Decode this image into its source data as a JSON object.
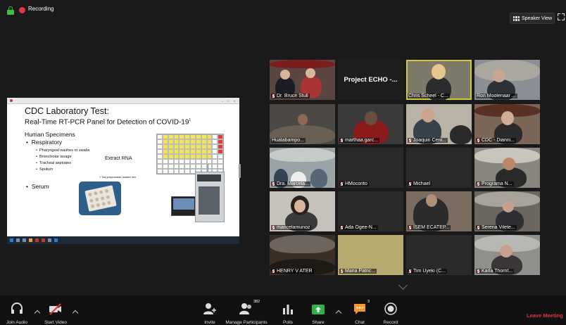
{
  "topbar": {
    "recording_label": "Recording",
    "speaker_view_label": "Speaker View"
  },
  "share": {
    "slide": {
      "title": "CDC Laboratory Test:",
      "subtitle_prefix": "Real-Time RT-PCR Panel for Detection of COVID-19",
      "subtitle_sup": "1",
      "specimens_heading": "Human Specimens",
      "bullet_respiratory": "Respiratory",
      "sub_bullets": [
        "Pharyngeal washes or swabs",
        "Bronchiolar lavage",
        "Tracheal aspirates",
        "Sputum"
      ],
      "bullet_serum": "Serum",
      "extract_label": "Extract RNA",
      "taq_label": "+ Taq polymerase master mix"
    }
  },
  "gallery": {
    "tiles": [
      {
        "name": "Dr. Bruce Stull",
        "muted": true
      },
      {
        "name": "Project ECHO -...",
        "muted": false,
        "name_only": true
      },
      {
        "name": "Chris Scheel - C...",
        "muted": false,
        "active": true
      },
      {
        "name": "Ron Moolenaar ...",
        "muted": false
      },
      {
        "name": "Huatabampo...",
        "muted": false
      },
      {
        "name": "marthaa.garc...",
        "muted": true
      },
      {
        "name": "Joaquin Cerv...",
        "muted": true
      },
      {
        "name": "CDC - Dianni...",
        "muted": true
      },
      {
        "name": "Dra. Marcela...",
        "muted": true
      },
      {
        "name": "HMocorito",
        "muted": true
      },
      {
        "name": "Michael",
        "muted": true
      },
      {
        "name": "Programa N...",
        "muted": true
      },
      {
        "name": "maricelamunoz",
        "muted": true
      },
      {
        "name": "Ada Ogee-N...",
        "muted": true
      },
      {
        "name": "ISEM ECATEP...",
        "muted": true
      },
      {
        "name": "Serena Vilete...",
        "muted": true
      },
      {
        "name": "HENRY V ATER",
        "muted": true
      },
      {
        "name": "Maria Patric...",
        "muted": true
      },
      {
        "name": "Tim Uyeki (C...",
        "muted": true
      },
      {
        "name": "Karla Thornt...",
        "muted": true
      }
    ]
  },
  "toolbar": {
    "join_audio": "Join Audio",
    "start_video": "Start Video",
    "invite": "Invite",
    "manage_participants": "Manage Participants",
    "participants_count": "382",
    "polls": "Polls",
    "share": "Share",
    "chat": "Chat",
    "chat_count": "3",
    "record": "Record",
    "leave_meeting": "Leave Meeting"
  },
  "colors": {
    "accent_green": "#3fbf3f",
    "record_red": "#e0383e",
    "active_border": "#d3c83a",
    "chat_orange": "#f29a2e",
    "share_green": "#2fb34a"
  }
}
